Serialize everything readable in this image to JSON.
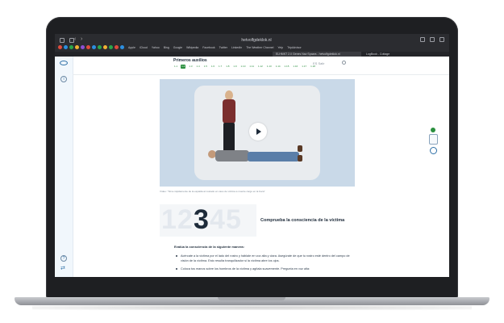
{
  "browser": {
    "url": "hetvolfgdeklok.nl",
    "bookmarks": [
      "Apple",
      "iCloud",
      "Yahoo",
      "Bing",
      "Google",
      "Wikipedia",
      "Facebook",
      "Twitter",
      "LinkedIn",
      "The Weather Channel",
      "Yelp",
      "TripAdvisor"
    ],
    "tabs": [
      "ELHMKT 2.0 Genes Nav Spaars - hetvolfgdeklok.nl",
      "LogBook - Cottage"
    ]
  },
  "header": {
    "course_title": "Primeros auxilios",
    "chips": [
      "1.1",
      "1.2",
      "1.3",
      "1.4",
      "1.5",
      "1.6",
      "1.7",
      "1.8",
      "1.9",
      "1.10",
      "1.11",
      "1.12",
      "1.13",
      "1.14",
      "1.15",
      "1.16",
      "1.17",
      "1.18"
    ],
    "active_chip_index": 1,
    "language": "ES  Salir"
  },
  "video": {
    "caption": "Vídeo: \"Sirve rápidamente de la espalda al costado en caso de víctima a muerte cargo en la boca\""
  },
  "steps": {
    "numbers": [
      "1",
      "2",
      "3",
      "4",
      "5"
    ],
    "active_index": 2,
    "title": "Comprueba la consciencia de la víctima"
  },
  "instructions": {
    "lead": "Evalúa la consciencia de la siguiente manera:",
    "bullets": [
      "Acércate a la víctima por el lado del rostro y háblale en voz alta y clara. Asegúrate de que tu rostro esté dentro del campo de visión de la víctima. Esto resulta tranquilizador si la víctima abre los ojos.",
      "Coloca tus manos sobre los hombros de la víctima y agítala suavemente. Pregunta en voz alta:"
    ]
  },
  "colors": {
    "accent_green": "#2a8f3e",
    "accent_blue": "#2d6fa6",
    "video_bg": "#c9d9e8"
  }
}
